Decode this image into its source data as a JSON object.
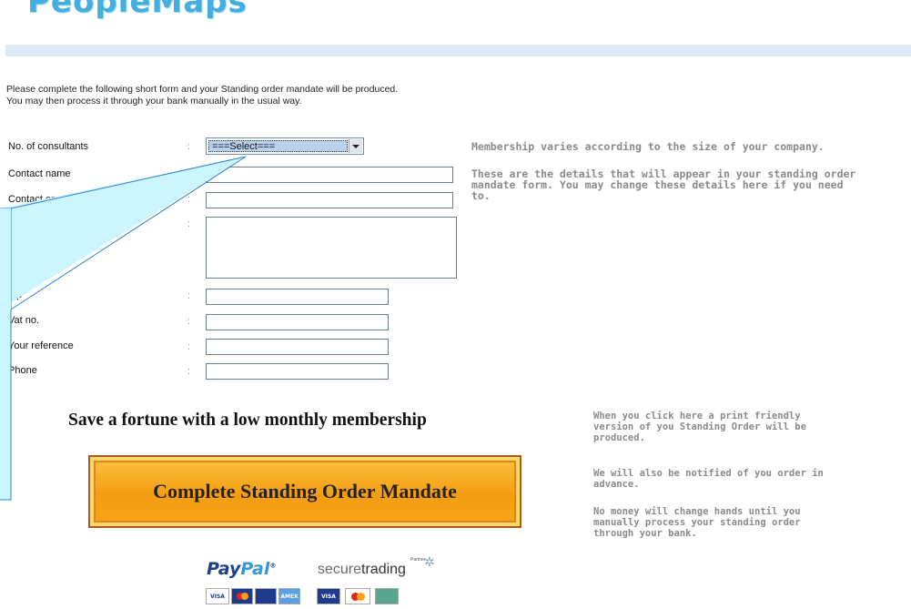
{
  "brand": {
    "logo_text": "PeopleMaps"
  },
  "intro": {
    "line1": "Please complete the following short form and your Standing order mandate will be produced.",
    "line2": "You may then process it through your bank manually in the usual way."
  },
  "form": {
    "fields": [
      {
        "label": "No. of consultants",
        "colon": ":"
      },
      {
        "label": "Contact name",
        "colon": ":"
      },
      {
        "label": "Contact em",
        "colon": ":"
      },
      {
        "label": "",
        "colon": ":"
      },
      {
        "label": "Zip",
        "colon": ":"
      },
      {
        "label": "Vat no.",
        "colon": ":"
      },
      {
        "label": "Your reference",
        "colon": ":"
      },
      {
        "label": "Phone",
        "colon": ":"
      }
    ],
    "select_value": "===Select==="
  },
  "help": {
    "membership": "Membership varies according to the size of your company.",
    "details_line1": "These are the details that will appear in your standing order",
    "details_line2": "mandate form. You may change these details here if you need",
    "details_line3": "to."
  },
  "promo": {
    "title": "Save a fortune with a low monthly membership"
  },
  "cta": {
    "label": "Complete Standing Order Mandate"
  },
  "side_help": {
    "p1_l1": "When you click here a print friendly",
    "p1_l2": "version of you Standing Order will be",
    "p1_l3": "produced.",
    "p2_l1": "We will also be notified of you order in",
    "p2_l2": "advance.",
    "p3_l1": "No money will change hands until you",
    "p3_l2": "manually process your standing order",
    "p3_l3": "through your bank."
  },
  "payments": {
    "paypal_a": "Pay",
    "paypal_b": "Pal",
    "paypal_tm": "®",
    "st_a": "secure",
    "st_b": "trading",
    "st_partner": "Partner",
    "cards": [
      "VISA",
      "",
      "",
      "AMEX",
      "VISA",
      "",
      ""
    ]
  },
  "colors": {
    "accent": "#43aee0",
    "cta_orange": "#f59d12",
    "callout_fill": "#ccf6ff"
  }
}
